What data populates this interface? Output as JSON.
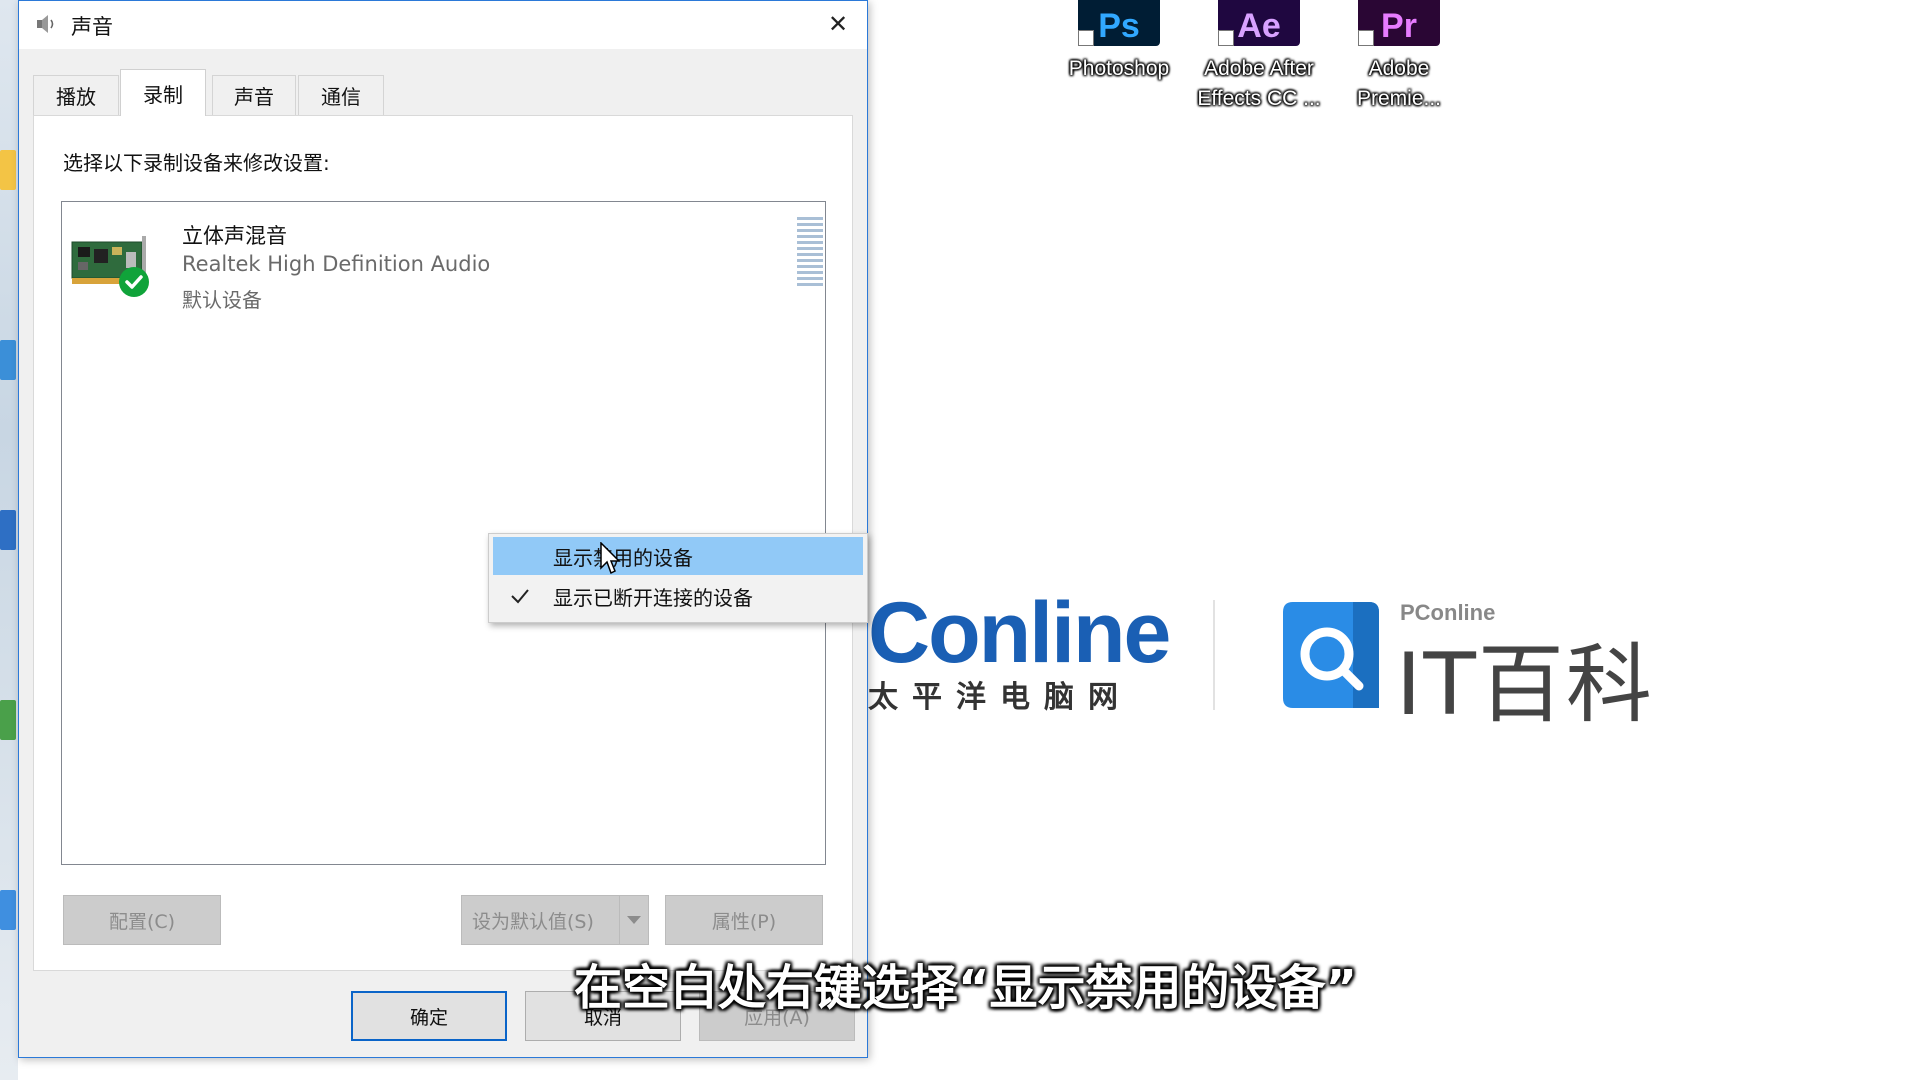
{
  "window": {
    "title": "声音",
    "close_glyph": "✕"
  },
  "tabs": [
    {
      "label": "播放",
      "active": false
    },
    {
      "label": "录制",
      "active": true
    },
    {
      "label": "声音",
      "active": false
    },
    {
      "label": "通信",
      "active": false
    }
  ],
  "panel": {
    "instruction": "选择以下录制设备来修改设置:"
  },
  "devices": [
    {
      "name": "立体声混音",
      "driver": "Realtek High Definition Audio",
      "status": "默认设备",
      "icon": "sound-card-icon",
      "badge": "default-check-icon"
    }
  ],
  "panel_buttons": {
    "configure": "配置(C)",
    "set_default": "设为默认值(S)",
    "properties": "属性(P)"
  },
  "dialog_buttons": {
    "ok": "确定",
    "cancel": "取消",
    "apply": "应用(A)"
  },
  "context_menu": {
    "items": [
      {
        "label": "显示禁用的设备",
        "checked": false,
        "highlighted": true
      },
      {
        "label": "显示已断开连接的设备",
        "checked": true,
        "highlighted": false
      }
    ]
  },
  "desktop_icons": [
    {
      "tile": "Ps",
      "label_line1": "Photoshop",
      "label_line2": "",
      "color": "#31a8ff",
      "bg": "#001d34"
    },
    {
      "tile": "Ae",
      "label_line1": "Adobe After",
      "label_line2": "Effects CC ...",
      "color": "#d8a1ff",
      "bg": "#1f0740"
    },
    {
      "tile": "Pr",
      "label_line1": "Adobe",
      "label_line2": "Premie...",
      "color": "#e77cff",
      "bg": "#2a0634"
    }
  ],
  "watermark": {
    "pconline_word": "Conline",
    "pconline_cn": "太平洋电脑网",
    "itbaike_small": "PConline",
    "itbaike_text": "IT百科"
  },
  "subtitle": "在空白处右键选择“显示禁用的设备”",
  "colors": {
    "accent": "#2b79d8",
    "menu_highlight": "#91c9f7",
    "check_green": "#10a33a",
    "pconline_blue": "#1a5fb4"
  }
}
